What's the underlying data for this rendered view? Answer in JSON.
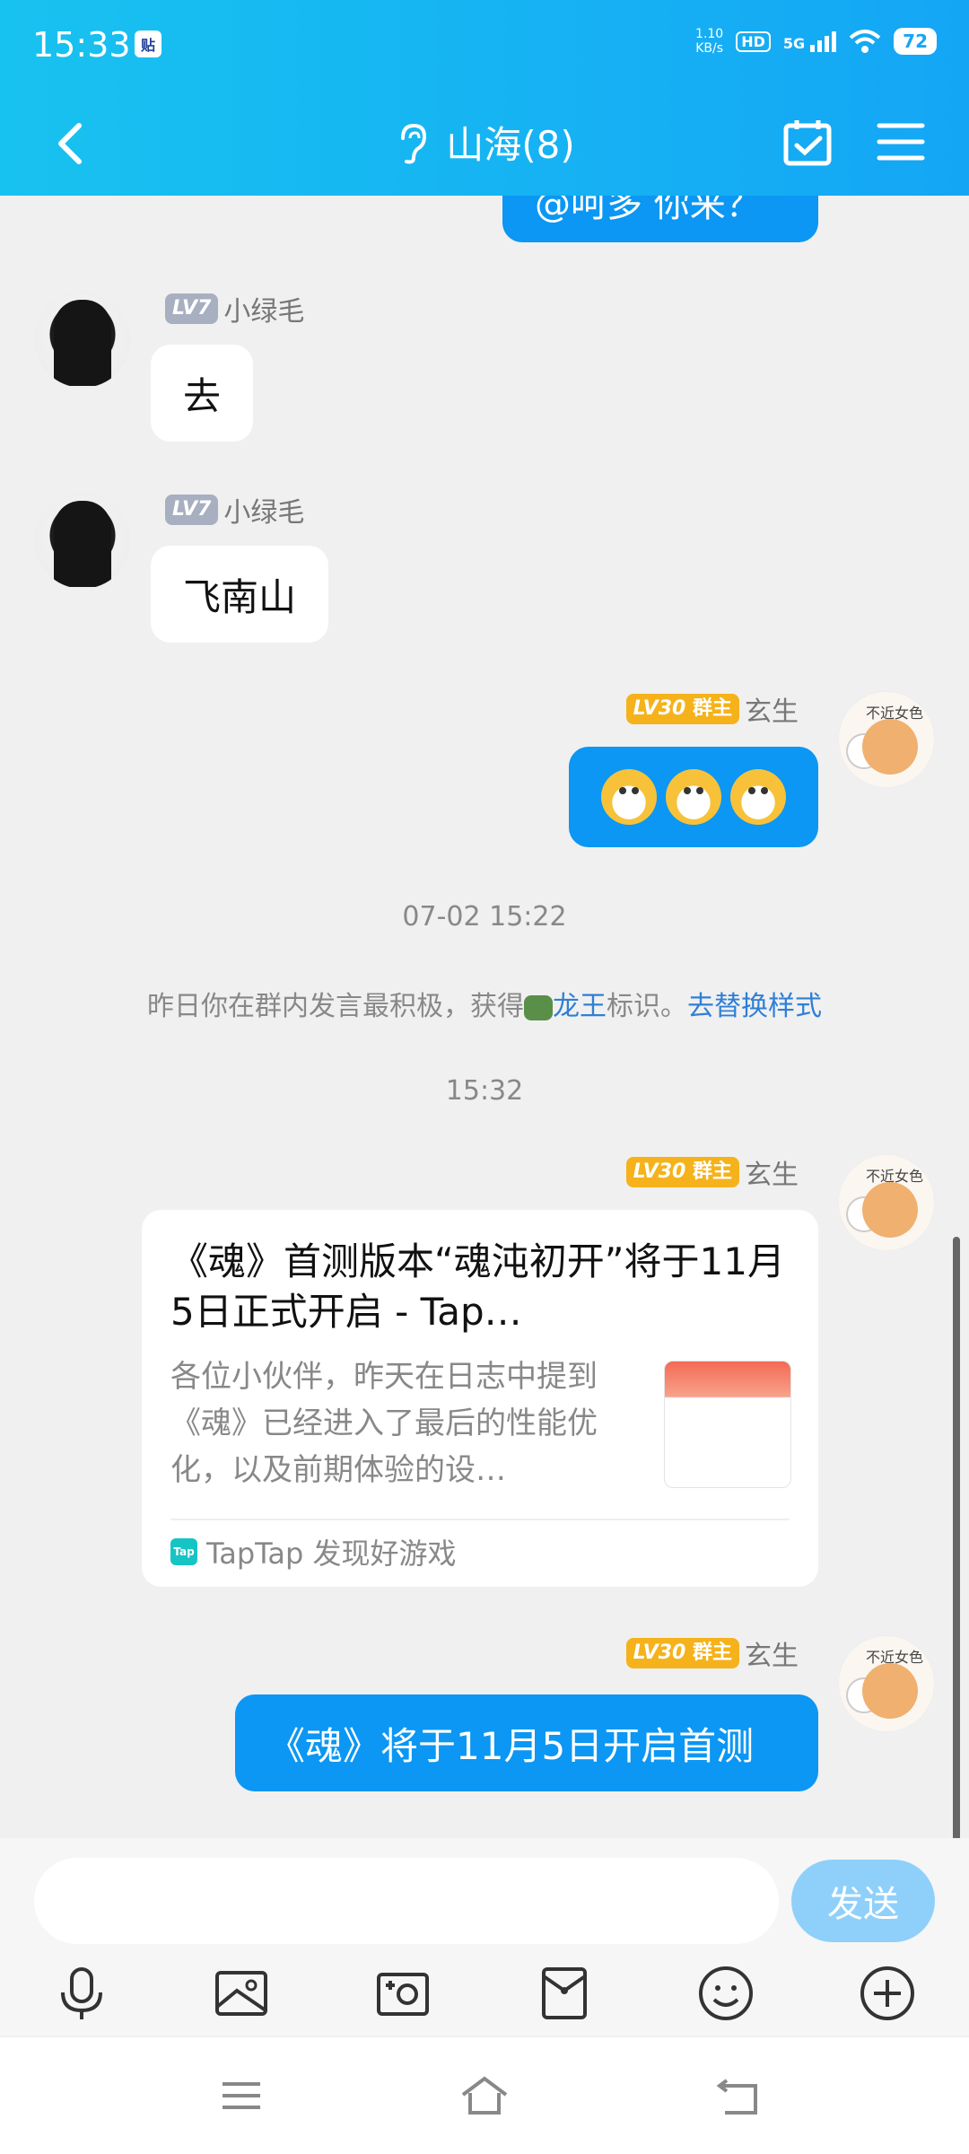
{
  "status_bar": {
    "time": "15:33",
    "app_badge": "贴",
    "net_speed": "1.10",
    "net_unit": "KB/s",
    "hd": "HD",
    "net_type": "5G",
    "battery": "72"
  },
  "header": {
    "title": "山海(8)"
  },
  "messages": [
    {
      "id": "partial_top",
      "text": "@呵多 你来？"
    },
    {
      "id": "m1",
      "level": "LV7",
      "name": "小绿毛",
      "text": "去"
    },
    {
      "id": "m2",
      "level": "LV7",
      "name": "小绿毛",
      "text": "飞南山"
    },
    {
      "id": "m3",
      "level": "LV30",
      "role": "群主",
      "name": "玄生"
    },
    {
      "id": "m5",
      "level": "LV30",
      "role": "群主",
      "name": "玄生"
    },
    {
      "id": "m6",
      "level": "LV30",
      "role": "群主",
      "name": "玄生",
      "text": "《魂》将于11月5日开启首测"
    }
  ],
  "system": {
    "time1": "07-02 15:22",
    "notice_prefix": "昨日你在群内发言最积极，获得",
    "notice_badge": "龙王",
    "notice_suffix": "标识。",
    "notice_link": "去替换样式",
    "time2": "15:32"
  },
  "card": {
    "title": "《魂》首测版本“魂沌初开”将于11月5日正式开启 - Tap…",
    "description": "各位小伙伴，昨天在日志中提到《魂》已经进入了最后的性能优化，以及前期体验的设…",
    "source_icon": "Tap",
    "source": "TapTap 发现好游戏"
  },
  "input": {
    "placeholder": "",
    "send_label": "发送"
  },
  "colors": {
    "header_start": "#18c2f0",
    "header_end": "#14a6f5",
    "bubble_blue": "#0b97f3",
    "send_disabled": "#8fd0fa",
    "link": "#2f7fd6",
    "owner_badge": "#f5b21b"
  },
  "icons": [
    "back-arrow-icon",
    "ear-icon",
    "calendar-check-icon",
    "menu-icon",
    "mic-icon",
    "image-icon",
    "camera-icon",
    "red-packet-icon",
    "emoji-icon",
    "plus-icon",
    "nav-menu-icon",
    "nav-home-icon",
    "nav-back-icon"
  ]
}
